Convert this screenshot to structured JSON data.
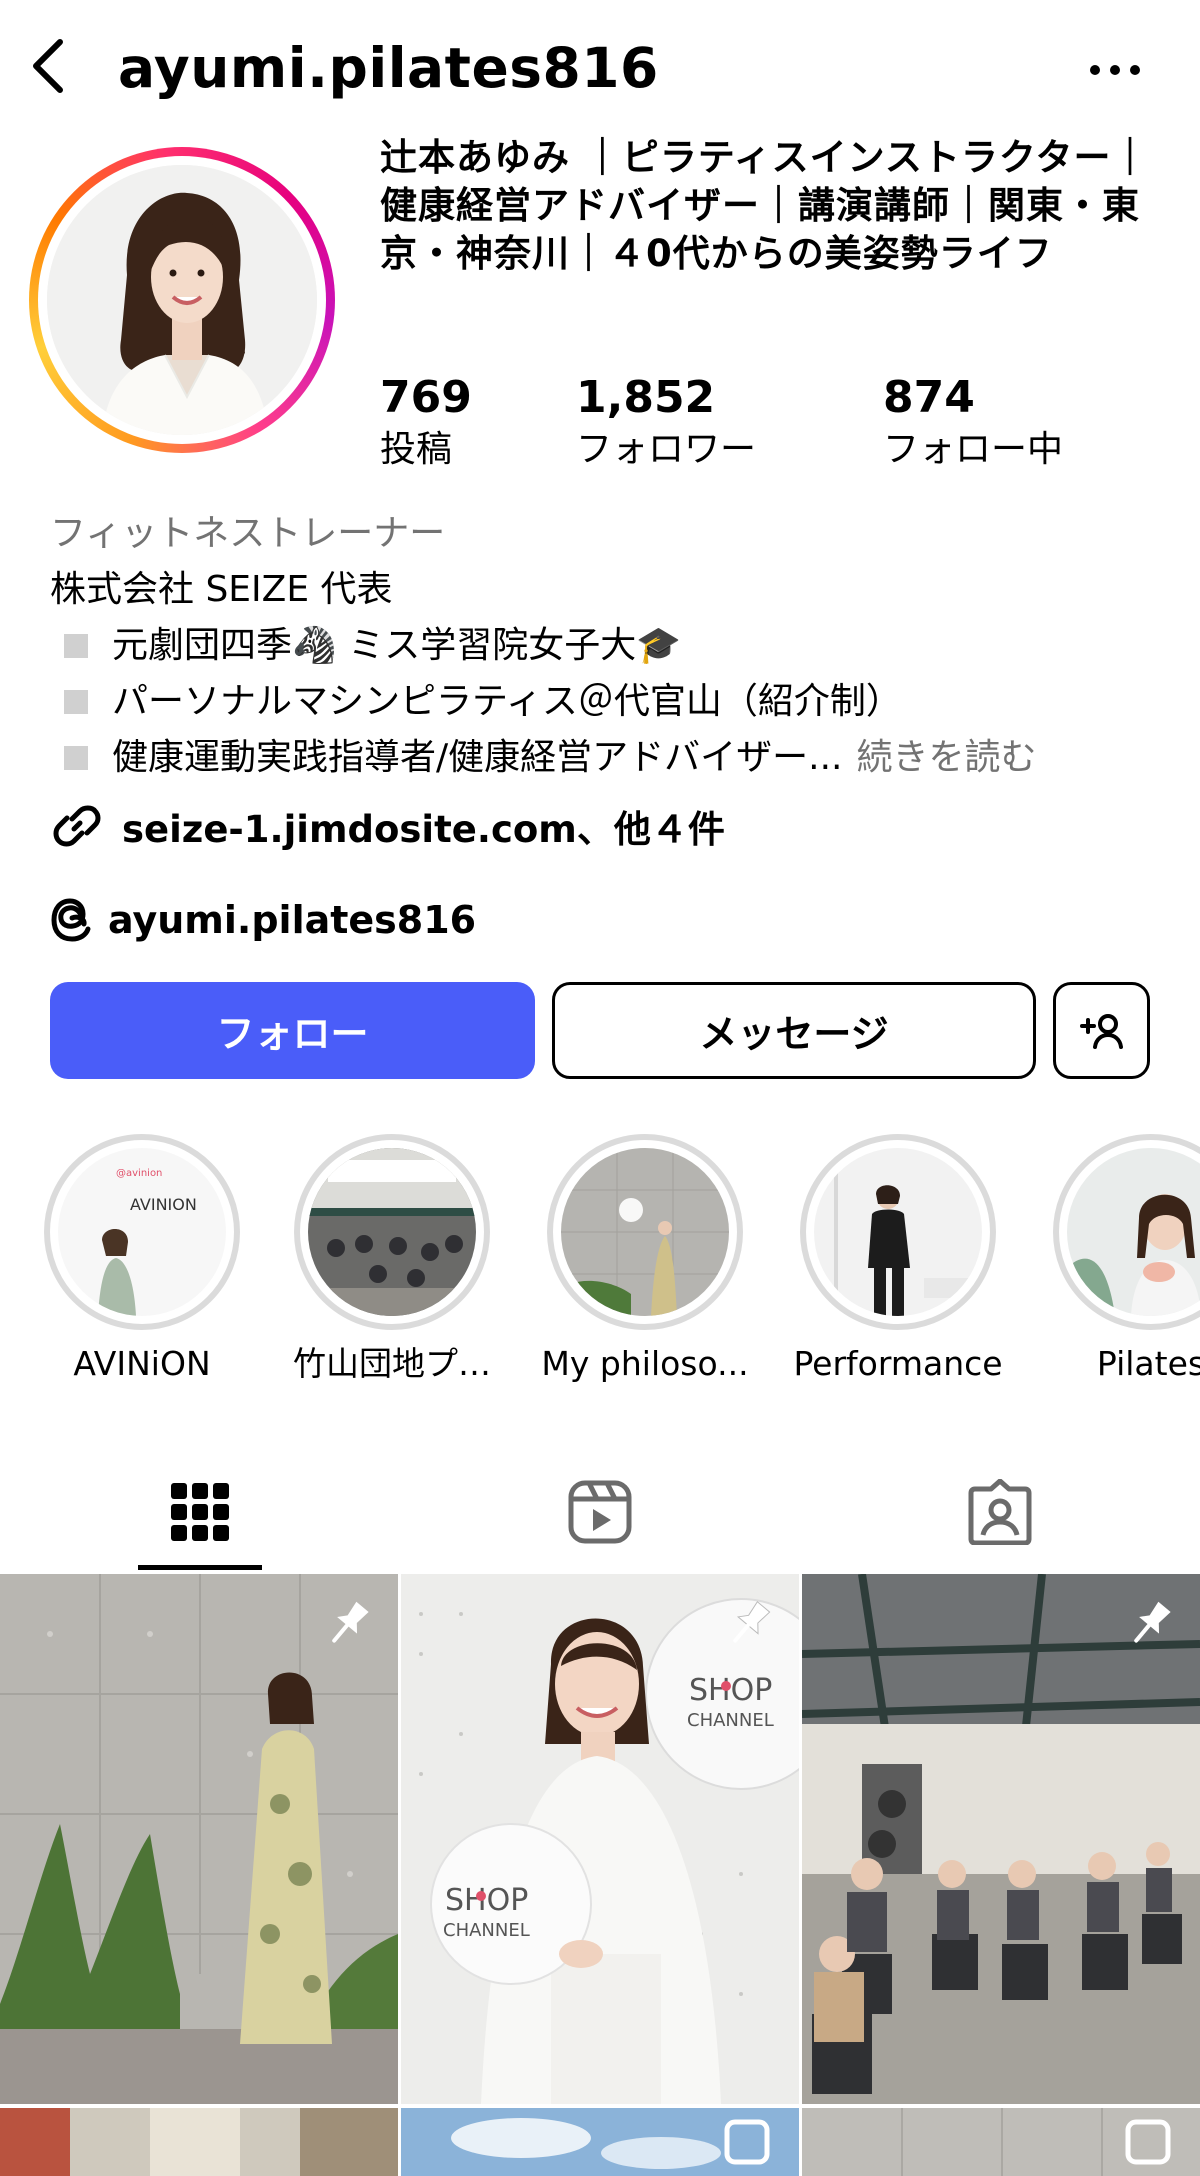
{
  "header": {
    "username": "ayumi.pilates816"
  },
  "profile": {
    "display_name": "辻本あゆみ ｜ピラティスインストラクター｜健康経営アドバイザー｜講演講師｜関東・東京・神奈川｜４0代からの美姿勢ライフ",
    "stats": [
      {
        "value": "769",
        "label": "投稿"
      },
      {
        "value": "1,852",
        "label": "フォロワー"
      },
      {
        "value": "874",
        "label": "フォロー中"
      }
    ]
  },
  "bio": {
    "category": "フィットネストレーナー",
    "line1": "株式会社 SEIZE 代表",
    "line2": "元劇団四季🦓 ミス学習院女子大🎓",
    "line3": "パーソナルマシンピラティス＠代官山（紹介制）",
    "line4": "健康運動実践指導者/健康経営アドバイザー...",
    "more": "続きを読む",
    "link": "seize-1.jimdosite.com、他４件",
    "threads": "ayumi.pilates816"
  },
  "actions": {
    "follow": "フォロー",
    "message": "メッセージ"
  },
  "highlights": [
    {
      "label": "AVINiON",
      "cover_text": "AVINION"
    },
    {
      "label": "竹山団地プ…"
    },
    {
      "label": "My philoso..."
    },
    {
      "label": "Performance"
    },
    {
      "label": "Pilates"
    }
  ],
  "posts": [
    {
      "pinned": true
    },
    {
      "pinned": true,
      "badge_top": "SHOP",
      "badge_bottom": "CHANNEL"
    },
    {
      "pinned": true
    }
  ],
  "colors": {
    "follow_button": "#4a5df9",
    "secondary_text": "#737373",
    "highlight_ring": "#dbdbdb"
  },
  "icons": {
    "back": "chevron-left-icon",
    "more": "more-horizontal-icon",
    "link": "link-icon",
    "threads": "threads-icon",
    "add_user": "add-user-icon",
    "grid_tab": "grid-icon",
    "reels_tab": "reels-icon",
    "tagged_tab": "tagged-icon",
    "pin": "pin-icon"
  }
}
